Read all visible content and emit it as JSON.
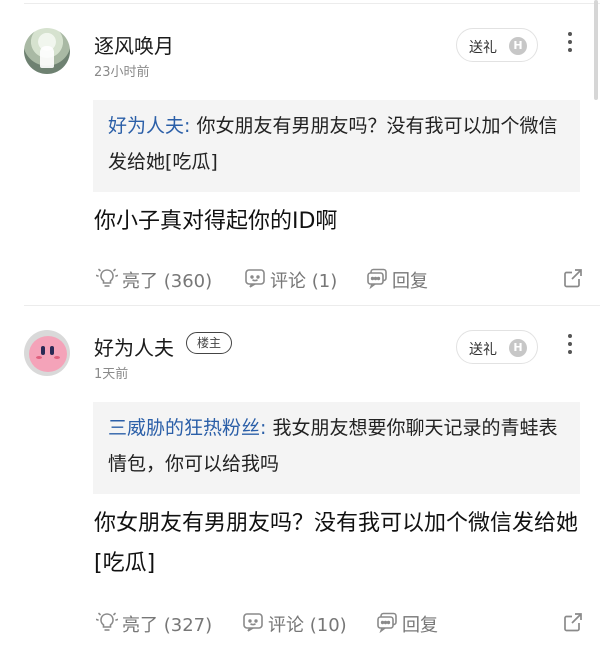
{
  "comments": [
    {
      "username": "逐风唤月",
      "badge": "",
      "time": "23小时前",
      "gift_label": "送礼",
      "gift_icon_letter": "H",
      "quote_name": "好为人夫:",
      "quote_text": " 你女朋友有男朋友吗？没有我可以加个微信发给她[吃瓜]",
      "body": "你小子真对得起你的ID啊",
      "like_label": "亮了 (360)",
      "comment_label": "评论 (1)",
      "reply_label": "回复"
    },
    {
      "username": "好为人夫",
      "badge": "楼主",
      "time": "1天前",
      "gift_label": "送礼",
      "gift_icon_letter": "H",
      "quote_name": "三威胁的狂热粉丝:",
      "quote_text": " 我女朋友想要你聊天记录的青蛙表情包，你可以给我吗",
      "body": "你女朋友有男朋友吗？没有我可以加个微信发给她[吃瓜]",
      "like_label": "亮了 (327)",
      "comment_label": "评论 (10)",
      "reply_label": "回复"
    }
  ],
  "colors": {
    "quote_name": "#2b5fa8",
    "quote_bg": "#f4f4f4",
    "meta_text": "#8a8a8a",
    "action_text": "#777777"
  },
  "icons": [
    "more-vertical-icon",
    "h-coin-icon",
    "lightbulb-like-icon",
    "comment-bubble-icon",
    "reply-bubble-icon",
    "share-icon"
  ]
}
